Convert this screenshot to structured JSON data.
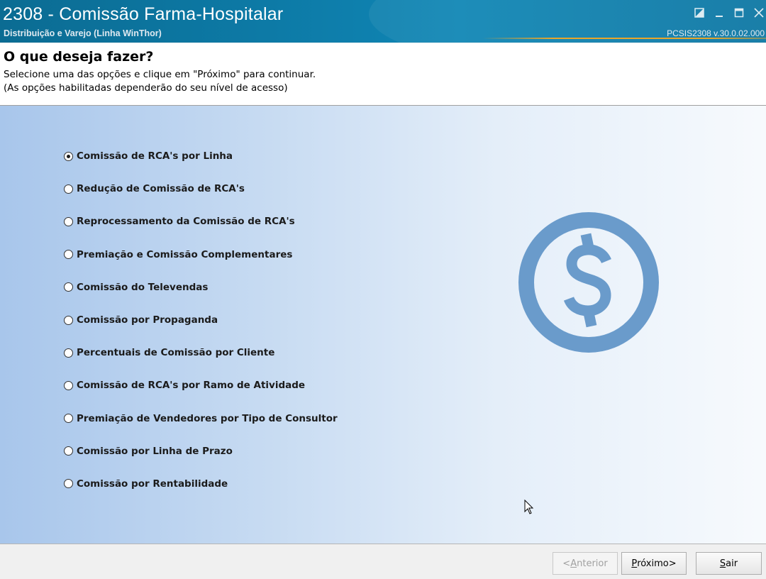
{
  "window": {
    "title": "2308 - Comissão Farma-Hospitalar",
    "subtitle": "Distribuição e Varejo (Linha WinThor)",
    "version": "PCSIS2308  v.30.0.02.000"
  },
  "header": {
    "title": "O que deseja fazer?",
    "line1": "Selecione uma das opções e clique em \"Próximo\" para continuar.",
    "line2": "(As opções habilitadas dependerão do seu nível de acesso)"
  },
  "options": [
    {
      "label": "Comissão de RCA's por Linha",
      "checked": true
    },
    {
      "label": "Redução de Comissão de RCA's",
      "checked": false
    },
    {
      "label": "Reprocessamento da Comissão de RCA's",
      "checked": false
    },
    {
      "label": "Premiação e Comissão Complementares",
      "checked": false
    },
    {
      "label": "Comissão do Televendas",
      "checked": false
    },
    {
      "label": "Comissão por Propaganda",
      "checked": false
    },
    {
      "label": "Percentuais de Comissão por Cliente",
      "checked": false
    },
    {
      "label": "Comissão de RCA's por Ramo de Atividade",
      "checked": false
    },
    {
      "label": "Premiação de Vendedores por Tipo de Consultor",
      "checked": false
    },
    {
      "label": "Comissão por Linha de Prazo",
      "checked": false
    },
    {
      "label": "Comissão por Rentabilidade",
      "checked": false
    }
  ],
  "buttons": {
    "previous": {
      "mnemonic": "A",
      "rest": "nterior",
      "prefix": "< ",
      "suffix": "",
      "enabled": false
    },
    "next": {
      "prefix": "",
      "mnemonic": "P",
      "rest": "róximo",
      "suffix": " >",
      "enabled": true
    },
    "exit": {
      "prefix": "",
      "mnemonic": "S",
      "rest": "air",
      "suffix": "",
      "enabled": true
    }
  },
  "colors": {
    "titlebar": "#0d7aa6",
    "accent_gold": "#e9a62a",
    "dollar_icon": "#6a9bcb"
  },
  "icons": {
    "dollar": "dollar-circle-icon",
    "cursor": "mouse-pointer-icon"
  }
}
